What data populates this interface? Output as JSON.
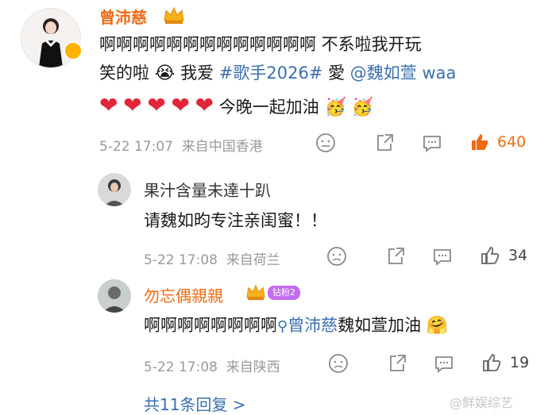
{
  "main_comment": {
    "author": "曾沛慈",
    "text_line1": "啊啊啊啊啊啊啊啊啊啊啊啊啊 不系啦我开玩",
    "text_line2_a": "笑的啦",
    "text_line2_b": "我爱",
    "hashtag": "#歌手2026#",
    "text_line2_c": "愛",
    "mention": "@魏如萱",
    "text_line2_d": "waa",
    "text_line3": "今晚一起加油",
    "date": "5-22 17:07",
    "location": "来自中国香港",
    "likes": "640"
  },
  "replies": [
    {
      "author": "果汁含量未達十趴",
      "text": "请魏如昀专注亲闺蜜！！",
      "date": "5-22 17:08",
      "location": "来自荷兰",
      "likes": "34"
    },
    {
      "author": "勿忘偶親親",
      "badge": "钻粉2",
      "text_a": "啊啊啊啊啊啊啊啊",
      "mention": "曾沛慈",
      "text_b": "魏如萱加油",
      "date": "5-22 17:08",
      "location": "来自陕西",
      "likes": "19"
    }
  ],
  "more_replies": "共11条回复 >",
  "watermark": "@鲜娱综艺",
  "colors": {
    "accent": "#f06a12",
    "link": "#3a6fb0",
    "heart": "#e3253a"
  }
}
